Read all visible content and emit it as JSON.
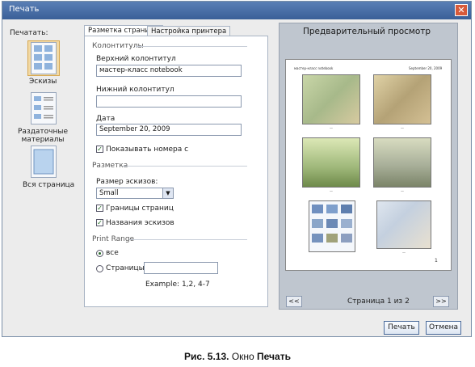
{
  "window": {
    "title": "Печать",
    "close_symbol": "✕"
  },
  "print_mode": {
    "label": "Печатать:",
    "options": [
      {
        "label": "Эскизы",
        "selected": true
      },
      {
        "label": "Раздаточные\nматериалы",
        "selected": false
      },
      {
        "label": "Вся страница",
        "selected": false
      }
    ]
  },
  "tabs": [
    {
      "label": "Разметка страницы",
      "active": true
    },
    {
      "label": "Настройка принтера",
      "active": false
    }
  ],
  "headers_section": {
    "title": "Колонтитулы",
    "header_label": "Верхний колонтитул",
    "header_value": "мастер-класс notebook",
    "footer_label": "Нижний колонтитул",
    "footer_value": "",
    "date_label": "Дата",
    "date_value": "September 20, 2009",
    "show_page_numbers_label": "Показывать номера с",
    "show_page_numbers_checked": true
  },
  "layout_section": {
    "title": "Разметка",
    "thumb_size_label": "Размер эскизов:",
    "thumb_size_value": "Small",
    "page_borders_label": "Границы страниц",
    "page_borders_checked": true,
    "thumb_names_label": "Названия эскизов",
    "thumb_names_checked": true
  },
  "print_range": {
    "title": "Print Range",
    "all_label": "все",
    "all_selected": true,
    "pages_label": "Страницы",
    "pages_value": "",
    "example": "Example: 1,2, 4-7"
  },
  "preview": {
    "title": "Предварительный просмотр",
    "page_header_left": "мастер-класс notebook",
    "page_header_right": "September 20, 2009",
    "page_number": "1",
    "prev_label": "<<",
    "next_label": ">>",
    "page_indicator": "Страница 1 из 2"
  },
  "buttons": {
    "print": "Печать",
    "cancel": "Отмена"
  },
  "figure_caption": {
    "prefix": "Рис. 5.13.",
    "text": "Окно",
    "bold": "Печать"
  }
}
